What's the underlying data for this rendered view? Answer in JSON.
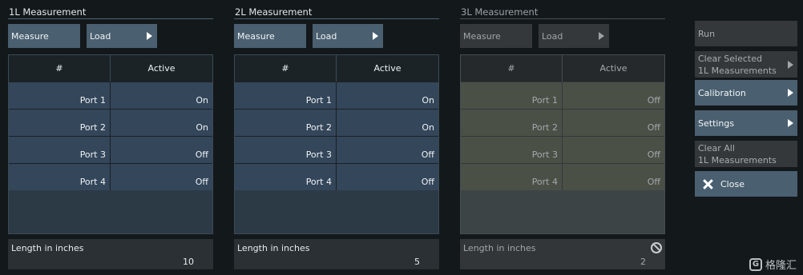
{
  "panels": [
    {
      "title": "1L Measurement",
      "measure_label": "Measure",
      "load_label": "Load",
      "col_num": "#",
      "col_active": "Active",
      "rows": [
        {
          "port": "Port 1",
          "state": "On"
        },
        {
          "port": "Port 2",
          "state": "On"
        },
        {
          "port": "Port 3",
          "state": "Off"
        },
        {
          "port": "Port 4",
          "state": "Off"
        }
      ],
      "length_label": "Length in inches",
      "length_value": "10"
    },
    {
      "title": "2L Measurement",
      "measure_label": "Measure",
      "load_label": "Load",
      "col_num": "#",
      "col_active": "Active",
      "rows": [
        {
          "port": "Port 1",
          "state": "On"
        },
        {
          "port": "Port 2",
          "state": "On"
        },
        {
          "port": "Port 3",
          "state": "Off"
        },
        {
          "port": "Port 4",
          "state": "Off"
        }
      ],
      "length_label": "Length in inches",
      "length_value": "5"
    },
    {
      "title": "3L Measurement",
      "measure_label": "Measure",
      "load_label": "Load",
      "col_num": "#",
      "col_active": "Active",
      "rows": [
        {
          "port": "Port 1",
          "state": "Off"
        },
        {
          "port": "Port 2",
          "state": "Off"
        },
        {
          "port": "Port 3",
          "state": "Off"
        },
        {
          "port": "Port 4",
          "state": "Off"
        }
      ],
      "length_label": "Length in inches",
      "length_value": "2"
    }
  ],
  "side": {
    "run": "Run",
    "clear_selected_1": "Clear Selected",
    "clear_selected_2": "1L Measurements",
    "calibration": "Calibration",
    "settings": "Settings",
    "clear_all_1": "Clear All",
    "clear_all_2": "1L Measurements",
    "close": "Close"
  },
  "watermark": "格隆汇",
  "icons": {
    "arrow": "chevron-right-icon",
    "close": "close-icon",
    "disabled": "no-entry-icon"
  },
  "colors": {
    "active_button": "#4a5f6f",
    "disabled_button": "#34383b",
    "cell": "#34465a",
    "background": "#13181b"
  }
}
